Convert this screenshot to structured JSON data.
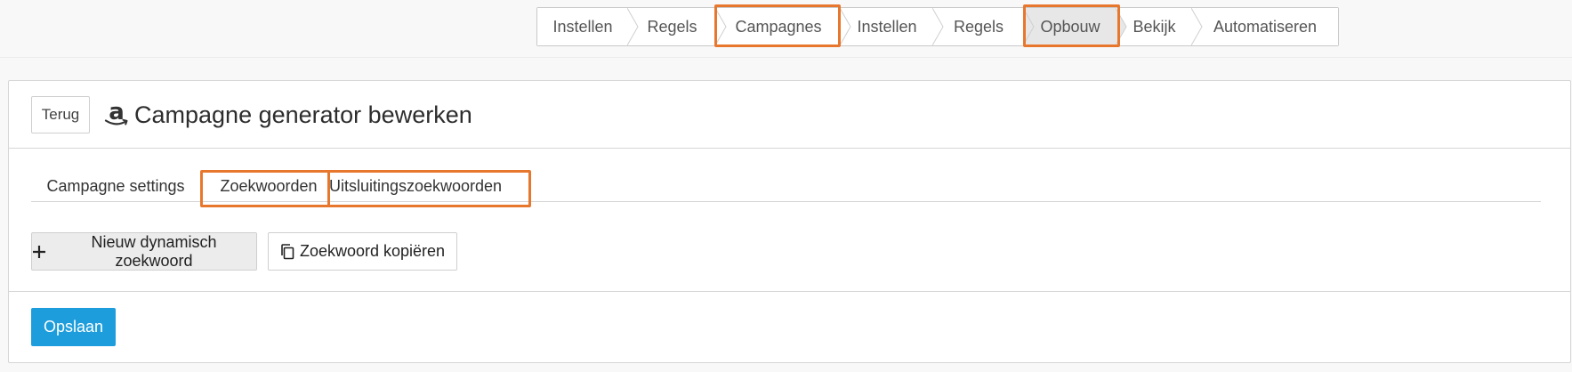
{
  "steps": [
    {
      "label": "Instellen"
    },
    {
      "label": "Regels"
    },
    {
      "label": "Campagnes"
    },
    {
      "label": "Instellen"
    },
    {
      "label": "Regels"
    },
    {
      "label": "Opbouw"
    },
    {
      "label": "Bekijk"
    },
    {
      "label": "Automatiseren"
    }
  ],
  "active_step": "Opbouw",
  "highlighted_steps": [
    "Campagnes",
    "Opbouw"
  ],
  "header": {
    "back_label": "Terug",
    "logo_icon": "amazon-icon",
    "title": "Campagne generator bewerken"
  },
  "tabs": [
    {
      "label": "Campagne settings"
    },
    {
      "label": "Zoekwoorden"
    },
    {
      "label": "Uitsluitingszoekwoorden"
    }
  ],
  "highlighted_tabs": [
    "Zoekwoorden",
    "Uitsluitingszoekwoorden"
  ],
  "actions": {
    "new_keyword_label": "Nieuw dynamisch zoekwoord",
    "new_keyword_icon": "plus-icon",
    "copy_keyword_label": "Zoekwoord kopiëren",
    "copy_keyword_icon": "copy-icon"
  },
  "footer": {
    "save_label": "Opslaan"
  },
  "colors": {
    "highlight": "#e8772e",
    "primary": "#1d9ddb",
    "active_step_bg": "#e7e7e7"
  }
}
